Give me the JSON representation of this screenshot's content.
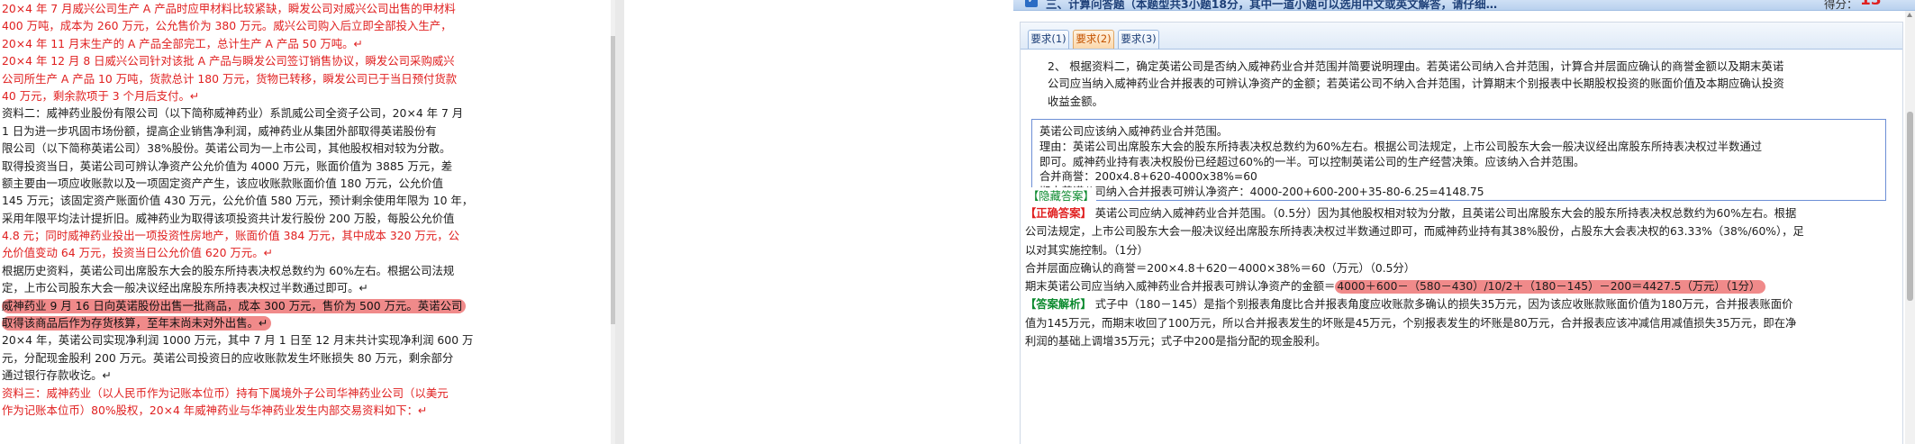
{
  "document": {
    "lines": [
      "20×4 年 7 月威兴公司生产 A 产品时应甲材料比较紧缺，瞬发公司对威兴公司出售的甲材料",
      "400 万吨，成本为 260 万元，公允售价为 380 万元。威兴公司购入后立即全部投入生产，",
      "20×4 年 11 月末生产的 A 产品全部完工，总计生产 A 产品 50 万吨。↵",
      "20×4 年 12 月 8 日威兴公司针对该批 A 产品与瞬发公司签订销售协议，瞬发公司采购威兴",
      "公司所生产 A 产品 10 万吨，货款总计 180 万元，货物已转移，瞬发公司已于当日预付货款",
      "40 万元，剩余款项于 3 个月后支付。↵",
      "资料二：威神药业股份有限公司（以下简称威神药业）系凯威公司全资子公司，20×4 年 7 月",
      "1 日为进一步巩固市场份额，提高企业销售净利润，威神药业从集团外部取得英诺股份有",
      "限公司（以下简称英诺公司）38%股份。英诺公司为一上市公司，其他股权相对较为分散。",
      "取得投资当日，英诺公司可辨认净资产公允价值为 4000 万元，账面价值为 3885 万元，差",
      "额主要由一项应收账款以及一项固定资产产生，该应收账款账面价值 180 万元，公允价值",
      "145 万元；该固定资产账面价值 430 万元，公允价值 580 万元，预计剩余使用年限为 10 年，",
      "采用年限平均法计提折旧。威神药业为取得该项投资共计发行股份 200 万股，每股公允价值",
      "4.8 元；同时威神药业投出一项投资性房地产，账面价值 384 万元，其中成本 320 万元，公",
      "允价值变动 64 万元，投资当日公允价值 620 万元。↵",
      "根据历史资料，英诺公司出席股东大会的股东所持表决权总数约为 60%左右。根据公司法规",
      "定，上市公司股东大会一般决议经出席股东所持表决权过半数通过即可。↵",
      "威神药业 9 月 16 日向英诺股份出售一批商品，成本 300 万元，售价为 500 万元。英诺公司",
      "取得该商品后作为存货核算，至年末尚未对外出售。↵",
      "20×4 年，英诺公司实现净利润 1000 万元，其中 7 月 1 日至 12 月末共计实现净利润 600 万",
      "元，分配现金股利 200 万元。英诺公司投资日的应收账款发生坏账损失 80 万元，剩余部分",
      "通过银行存款收讫。↵",
      "资料三：威神药业（以人民币作为记账本位币）持有下属境外子公司华神药业公司（以美元",
      "作为记账本位币）80%股权，20×4 年威神药业与华神药业发生内部交易资料如下：↵"
    ]
  },
  "exam": {
    "header": {
      "title": "三、计算问答题（本题型共3小题18分，其中一道小题可以选用中文或英文解答，请仔细…",
      "score_label": "得分：",
      "score_value": "13"
    },
    "tabs": [
      "要求(1)",
      "要求(2)",
      "要求(3)"
    ],
    "active_tab": 1,
    "question": [
      "2、 根据资料二，确定英诺公司是否纳入威神药业合并范围并简要说明理由。若英诺公司纳入合并范围，计算合并层面应确认的商誉金额以及期末英诺",
      "公司应当纳入威神药业合并报表的可辨认净资产的金额；若英诺公司不纳入合并范围，计算期末个别报表中长期股权投资的账面价值及本期应确认投资",
      "收益金额。"
    ],
    "user_answer": [
      "英诺公司应该纳入威神药业合并范围。",
      "理由：英诺公司出席股东大会的股东所持表决权总数约为60%左右。根据公司法规定，上市公司股东大会一般决议经出席股东所持表决权过半数通过",
      "即可。威神药业持有表决权股份已经超过60%的一半。可以控制英诺公司的生产经营决策。应该纳入合并范围。",
      "合并商誉：200x4.8+620-4000x38%=60",
      "期末英诺公司纳入合并报表可辨认净资产：4000-200+600-200+35-80-6.25=4148.75"
    ],
    "hide_answer_label": "【隐藏答案】",
    "solution": {
      "correct_tag": "【正确答案】",
      "correct_lines": [
        " 英诺公司应纳入威神药业合并范围。（0.5分）因为其他股权相对较为分散，且英诺公司出席股东大会的股东所持表决权总数约为60%左右。根据",
        "公司法规定，上市公司股东大会一般决议经出席股东所持表决权过半数通过即可，而威神药业持有其38%股份，占股东大会表决权的63.33%（38%/60%），足",
        "以对其实施控制。（1分）",
        "合并层面应确认的商誉＝200×4.8＋620－4000×38%＝60（万元）（0.5分）"
      ],
      "final_prefix": "期末英诺公司应当纳入威神药业合并报表可辨认净资产的金额＝",
      "final_value": "4000＋600－（580－430）/10/2＋（180－145）－200＝4427.5（万元）（1分）",
      "analysis_tag": "【答案解析】",
      "analysis_lines": [
        " 式子中（180－145）是指个别报表角度比合并报表角度应收账款多确认的损失35万元，因为该应收账款账面价值为180万元，合并报表账面价",
        "值为145万元，而期末收回了100万元，所以合并报表发生的坏账是45万元，个别报表发生的坏账是80万元，合并报表应该冲减信用减值损失35万元，即在净",
        "利润的基础上调增35万元；式子中200是指分配的现金股利。"
      ]
    }
  }
}
